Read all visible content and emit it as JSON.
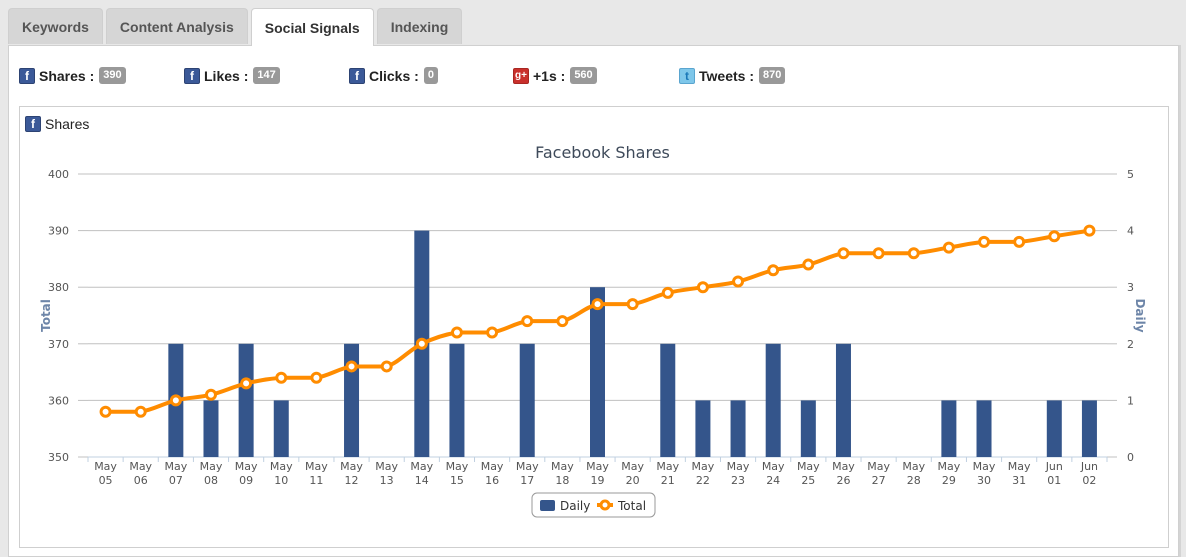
{
  "tabs": [
    {
      "label": "Keywords",
      "active": false
    },
    {
      "label": "Content Analysis",
      "active": false
    },
    {
      "label": "Social Signals",
      "active": true
    },
    {
      "label": "Indexing",
      "active": false
    }
  ],
  "stats": [
    {
      "icon": "facebook-icon",
      "glyph": "f",
      "label": "Shares :",
      "value": "390"
    },
    {
      "icon": "facebook-icon",
      "glyph": "f",
      "label": "Likes :",
      "value": "147"
    },
    {
      "icon": "facebook-icon",
      "glyph": "f",
      "label": "Clicks :",
      "value": "0"
    },
    {
      "icon": "google-plus-icon",
      "glyph": "g+",
      "label": "+1s :",
      "value": "560"
    },
    {
      "icon": "twitter-icon",
      "glyph": "t",
      "label": "Tweets :",
      "value": "870"
    }
  ],
  "chart_header": {
    "icon": "facebook-icon",
    "glyph": "f",
    "label": "Shares"
  },
  "colors": {
    "daily": "#34558b",
    "total": "#ff8c00",
    "axis_title": "#6d85a8",
    "grid": "#c0c0c0"
  },
  "chart_data": {
    "type": "bar+line",
    "title": "Facebook Shares",
    "categories": [
      "May 05",
      "May 06",
      "May 07",
      "May 08",
      "May 09",
      "May 10",
      "May 11",
      "May 12",
      "May 13",
      "May 14",
      "May 15",
      "May 16",
      "May 17",
      "May 18",
      "May 19",
      "May 20",
      "May 21",
      "May 22",
      "May 23",
      "May 24",
      "May 25",
      "May 26",
      "May 27",
      "May 28",
      "May 29",
      "May 30",
      "May 31",
      "Jun 01",
      "Jun 02"
    ],
    "series": [
      {
        "name": "Daily",
        "type": "bar",
        "axis": "right",
        "values": [
          0,
          0,
          2,
          1,
          2,
          1,
          0,
          2,
          0,
          4,
          2,
          0,
          2,
          0,
          3,
          0,
          2,
          1,
          1,
          2,
          1,
          2,
          0,
          0,
          1,
          1,
          0,
          1,
          1
        ]
      },
      {
        "name": "Total",
        "type": "line",
        "axis": "left",
        "values": [
          358,
          358,
          360,
          361,
          363,
          364,
          364,
          366,
          366,
          370,
          372,
          372,
          374,
          374,
          377,
          377,
          379,
          380,
          381,
          383,
          384,
          386,
          386,
          386,
          387,
          388,
          388,
          389,
          390
        ]
      }
    ],
    "yaxis_left": {
      "title": "Total",
      "range": [
        350,
        400
      ],
      "ticks": [
        350,
        360,
        370,
        380,
        390,
        400
      ]
    },
    "yaxis_right": {
      "title": "Daily",
      "range": [
        0,
        5
      ],
      "ticks": [
        0,
        1,
        2,
        3,
        4,
        5
      ]
    },
    "grid": true,
    "legend": {
      "position": "bottom-center",
      "entries": [
        "Daily",
        "Total"
      ]
    }
  }
}
